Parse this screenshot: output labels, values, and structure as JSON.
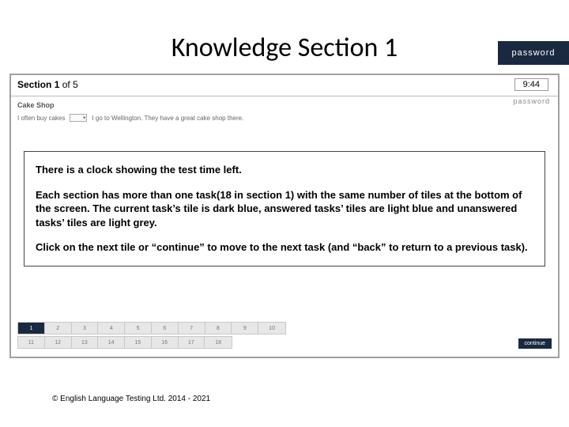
{
  "slide": {
    "title": "Knowledge Section 1"
  },
  "brand": {
    "corner_label": "password",
    "mini_label": "password"
  },
  "app": {
    "section_prefix": "Section ",
    "section_num": "1",
    "section_mid": " of ",
    "section_total": "5",
    "clock": "9:44",
    "task_title": "Cake Shop",
    "task_sentence_a": "I often buy cakes",
    "task_sentence_b": "I go to Wellington. They have a great cake shop there.",
    "tiles_row1": [
      "1",
      "2",
      "3",
      "4",
      "5",
      "6",
      "7",
      "8",
      "9",
      "10"
    ],
    "tiles_row2": [
      "11",
      "12",
      "13",
      "14",
      "15",
      "16",
      "17",
      "18"
    ],
    "continue_label": "continue"
  },
  "info": {
    "p1": "There is a clock showing the test time left.",
    "p2": "Each section has more than one task(18 in section 1) with the same number of tiles at the bottom of the screen. The current task’s tile is dark blue, answered tasks’ tiles are light blue and unanswered tasks’ tiles are light grey.",
    "p3": "Click on the next tile or “continue” to move to the next task (and “back” to return to a previous task)."
  },
  "footer": {
    "copyright": "© English Language Testing Ltd. 2014 - 2021"
  }
}
